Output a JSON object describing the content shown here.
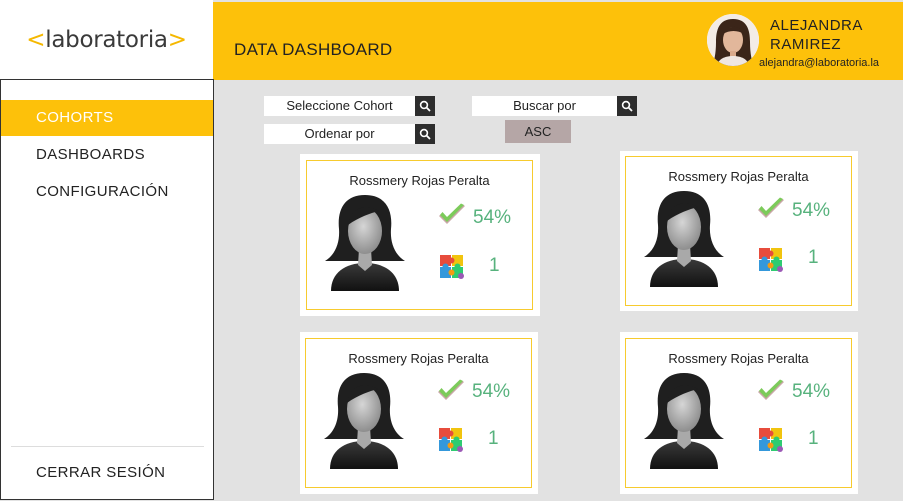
{
  "logo": {
    "open": "<",
    "text": "laboratoria",
    "close": ">"
  },
  "header": {
    "title": "DATA DASHBOARD",
    "user": {
      "first_name": "ALEJANDRA",
      "last_name": "RAMIREZ",
      "email": "alejandra@laboratoria.la"
    }
  },
  "sidebar": {
    "items": [
      {
        "label": "COHORTS",
        "active": true
      },
      {
        "label": "DASHBOARDS",
        "active": false
      },
      {
        "label": "CONFIGURACIÓN",
        "active": false
      }
    ],
    "logout_label": "CERRAR SESIÓN"
  },
  "filters": {
    "cohort_label": "Seleccione Cohort",
    "order_label": "Ordenar por",
    "search_label": "Buscar por",
    "asc_label": "ASC"
  },
  "cards": [
    {
      "name": "Rossmery Rojas Peralta",
      "percentage": "54%",
      "count": "1"
    },
    {
      "name": "Rossmery Rojas Peralta",
      "percentage": "54%",
      "count": "1"
    },
    {
      "name": "Rossmery Rojas Peralta",
      "percentage": "54%",
      "count": "1"
    },
    {
      "name": "Rossmery Rojas Peralta",
      "percentage": "54%",
      "count": "1"
    }
  ],
  "colors": {
    "accent": "#fdc10a",
    "success": "#57b27d",
    "sidebar_border": "#333333",
    "asc_button": "#b5a6a6"
  },
  "icons": {
    "search": "search-icon",
    "check": "check-icon",
    "puzzle": "puzzle-icon",
    "silhouette": "user-silhouette-icon"
  }
}
